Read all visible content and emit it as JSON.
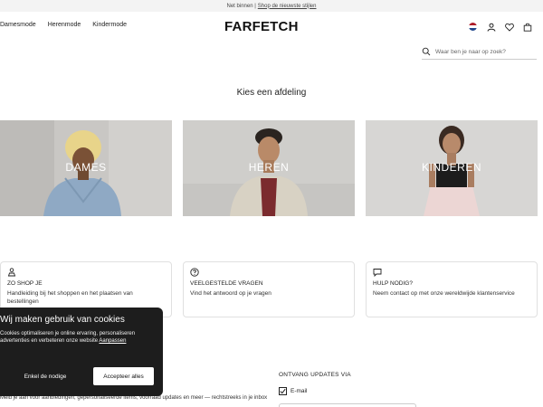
{
  "topbar": {
    "prefix": "Net binnen |",
    "link": "Shop de nieuwste stijlen"
  },
  "nav": {
    "items": [
      "Damesmode",
      "Herenmode",
      "Kindermode"
    ]
  },
  "logo": "FARFETCH",
  "header_icons": [
    "netherlands-flag-icon",
    "account-icon",
    "heart-icon",
    "bag-icon"
  ],
  "search": {
    "placeholder": "Waar ben je naar op zoek?"
  },
  "heading": "Kies een afdeling",
  "departments": [
    {
      "label": "DAMES"
    },
    {
      "label": "HEREN"
    },
    {
      "label": "KINDEREN"
    }
  ],
  "cards": [
    {
      "icon": "shopping-person-icon",
      "title": "ZO SHOP JE",
      "desc": "Handleiding bij het shoppen en het plaatsen van bestellingen"
    },
    {
      "icon": "question-icon",
      "title": "VEELGESTELDE VRAGEN",
      "desc": "Vind het antwoord op je vragen"
    },
    {
      "icon": "chat-icon",
      "title": "HULP NODIG?",
      "desc": "Neem contact op met onze wereldwijde klantenservice"
    }
  ],
  "cookie": {
    "title": "Wij maken gebruik van cookies",
    "body": "Cookies optimaliseren je online ervaring, personaliseren advertenties en verbeteren onze website",
    "link": "Aanpassen",
    "settings_label": "Enkel de nodige",
    "accept_label": "Accepteer alles"
  },
  "newsletter": {
    "title": "ONTVANG UPDATES VIA",
    "email_label": "E-mail",
    "email_checked": true,
    "footer_text": "Meld je aan voor aanbiedingen, gepersonaliseerde items, voorraad updates en meer — rechtstreeks in je inbox"
  },
  "colors": {
    "cookie_bg": "#1d1d1d",
    "accent": "#111111"
  }
}
